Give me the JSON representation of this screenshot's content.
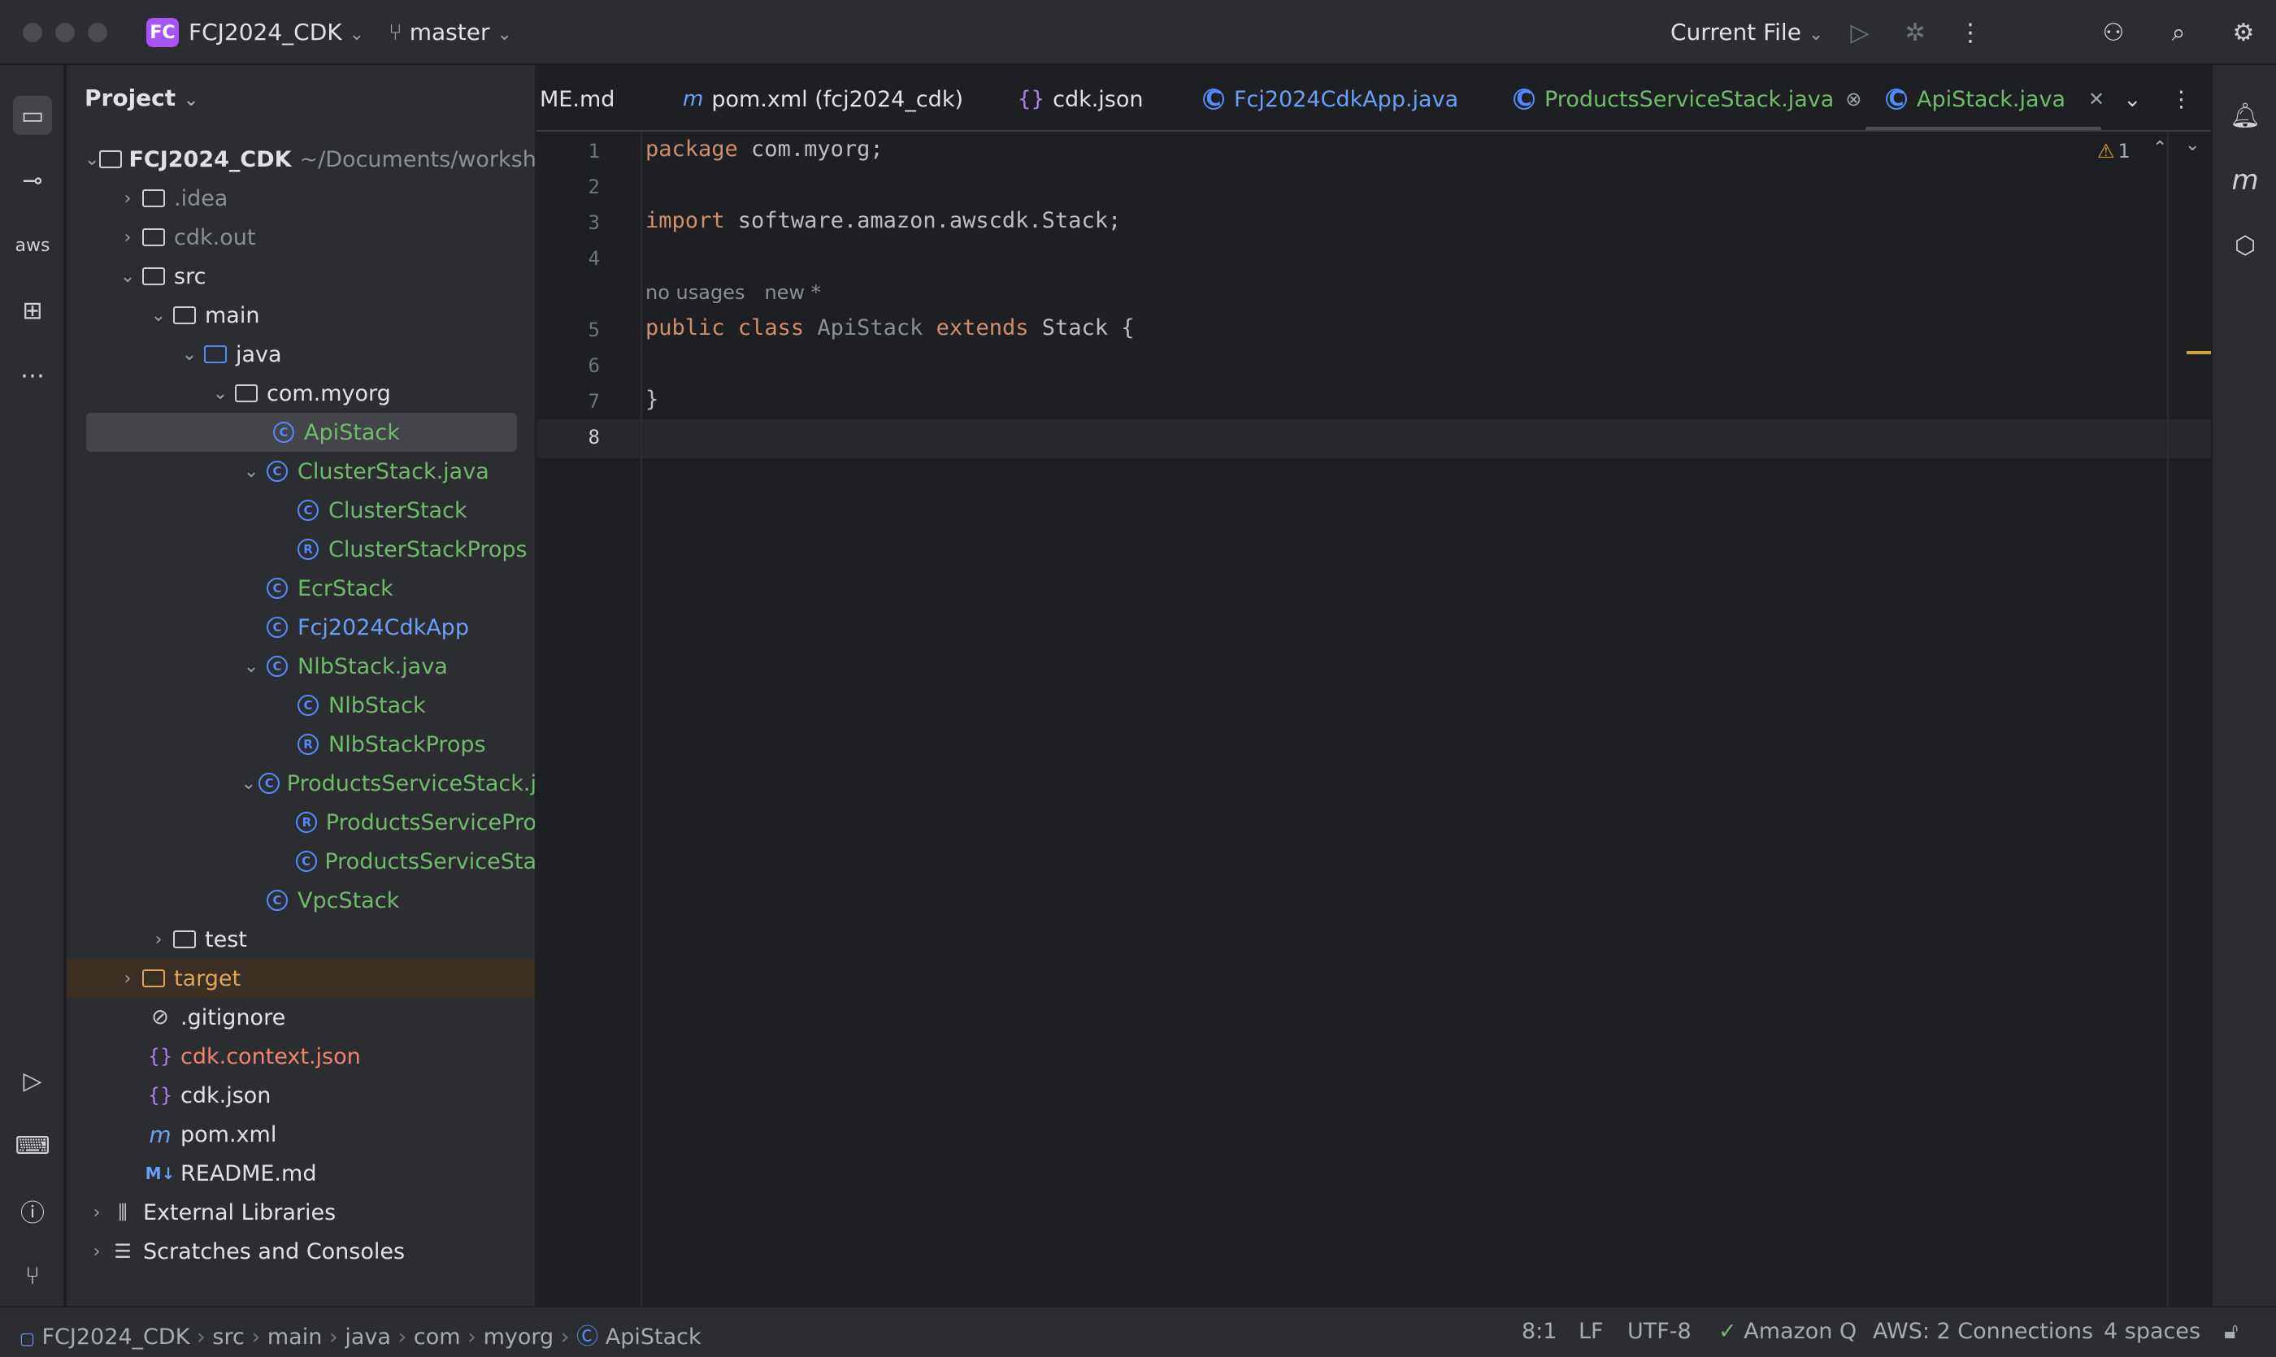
{
  "titlebar": {
    "project_badge": "FC",
    "project_name": "FCJ2024_CDK",
    "branch": "master",
    "run_config": "Current File"
  },
  "project_panel": {
    "title": "Project",
    "tree": [
      {
        "label": "FCJ2024_CDK",
        "suffix": "~/Documents/worksho"
      },
      {
        "label": ".idea"
      },
      {
        "label": "cdk.out"
      },
      {
        "label": "src"
      },
      {
        "label": "main"
      },
      {
        "label": "java"
      },
      {
        "label": "com.myorg"
      },
      {
        "label": "ApiStack"
      },
      {
        "label": "ClusterStack.java"
      },
      {
        "label": "ClusterStack"
      },
      {
        "label": "ClusterStackProps"
      },
      {
        "label": "EcrStack"
      },
      {
        "label": "Fcj2024CdkApp"
      },
      {
        "label": "NlbStack.java"
      },
      {
        "label": "NlbStack"
      },
      {
        "label": "NlbStackProps"
      },
      {
        "label": "ProductsServiceStack.j"
      },
      {
        "label": "ProductsServicePro"
      },
      {
        "label": "ProductsServiceSta"
      },
      {
        "label": "VpcStack"
      },
      {
        "label": "test"
      },
      {
        "label": "target"
      },
      {
        "label": ".gitignore"
      },
      {
        "label": "cdk.context.json"
      },
      {
        "label": "cdk.json"
      },
      {
        "label": "pom.xml"
      },
      {
        "label": "README.md"
      },
      {
        "label": "External Libraries"
      },
      {
        "label": "Scratches and Consoles"
      }
    ]
  },
  "tabs": [
    {
      "label": "ME.md"
    },
    {
      "label": "pom.xml (fcj2024_cdk)",
      "icon": "m"
    },
    {
      "label": "cdk.json",
      "icon": "{}"
    },
    {
      "label": "Fcj2024CdkApp.java",
      "icon": "C"
    },
    {
      "label": "ProductsServiceStack.java",
      "icon": "C"
    },
    {
      "label": "ApiStack.java",
      "icon": "C"
    }
  ],
  "editor": {
    "line_numbers": [
      "1",
      "2",
      "3",
      "4",
      "5",
      "6",
      "7",
      "8"
    ],
    "lines": {
      "l1_kw": "package",
      "l1_rest": " com.myorg;",
      "l3_kw": "import",
      "l3_rest": " software.amazon.awscdk.Stack;",
      "hint_usages": "no usages",
      "hint_new": "new *",
      "l5_kw1": "public",
      "l5_kw2": "class",
      "l5_name": "ApiStack",
      "l5_kw3": "extends",
      "l5_rest": " Stack {",
      "l7": "}"
    },
    "warnings_count": "1"
  },
  "statusbar": {
    "breadcrumb": [
      "FCJ2024_CDK",
      "src",
      "main",
      "java",
      "com",
      "myorg",
      "ApiStack"
    ],
    "position": "8:1",
    "line_sep": "LF",
    "encoding": "UTF-8",
    "amazon_q": "Amazon Q",
    "aws": "AWS: 2 Connections",
    "indent": "4 spaces"
  }
}
